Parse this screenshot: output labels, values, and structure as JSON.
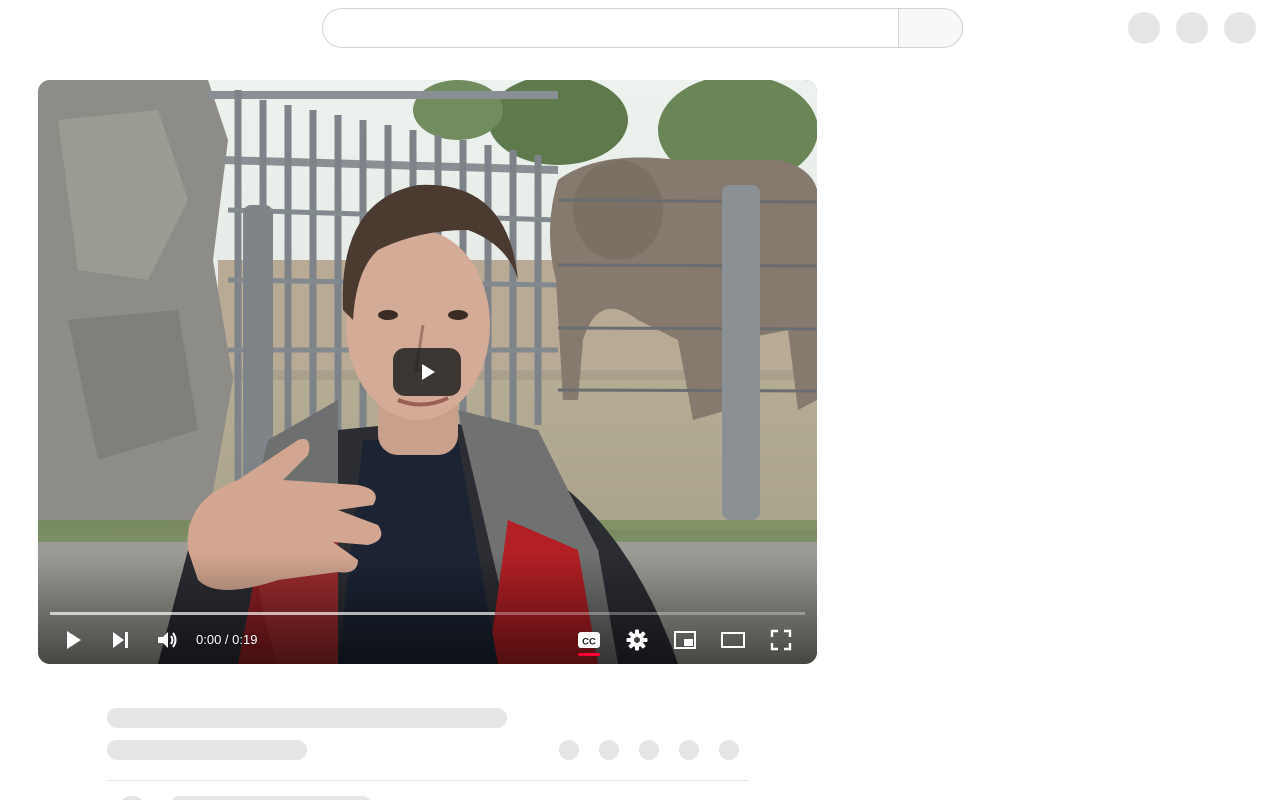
{
  "player": {
    "time_display": "0:00 / 0:19",
    "progress_fraction": 0.0,
    "buffered_fraction": 0.59,
    "captions_on": true,
    "accent_color": "#ff0033"
  },
  "icons": {
    "big_play": "play-icon",
    "play": "play-icon",
    "next": "skip-next-icon",
    "volume": "volume-icon",
    "captions": "closed-captions-icon",
    "settings": "gear-icon",
    "miniplayer": "miniplayer-icon",
    "theater": "theater-mode-icon",
    "fullscreen": "fullscreen-icon"
  },
  "colors": {
    "placeholder": "#e5e5e5",
    "background": "#ffffff"
  }
}
